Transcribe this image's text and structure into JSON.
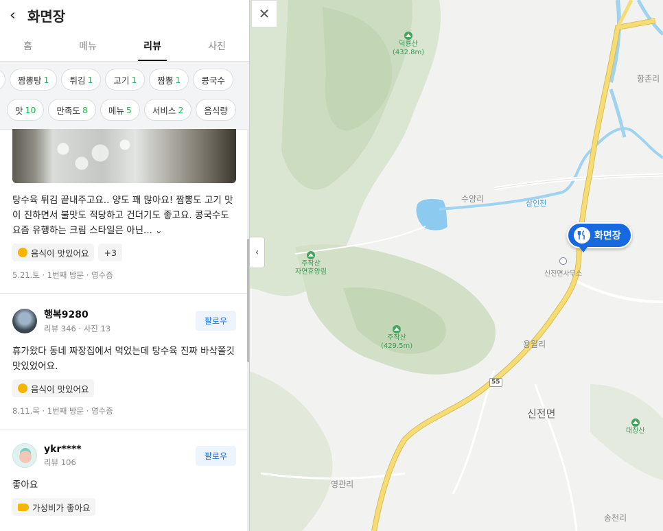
{
  "panel": {
    "title": "화면장",
    "tabs": [
      {
        "label": "홈"
      },
      {
        "label": "메뉴"
      },
      {
        "label": "리뷰"
      },
      {
        "label": "사진"
      }
    ],
    "keyword_chips_row1": [
      {
        "label": "짬뽕탕",
        "count": "1"
      },
      {
        "label": "튀김",
        "count": "1"
      },
      {
        "label": "고기",
        "count": "1"
      },
      {
        "label": "짬뽕",
        "count": "1"
      },
      {
        "label": "콩국수",
        "count": ""
      }
    ],
    "keyword_chips_row2": [
      {
        "label": "맛",
        "count": "10"
      },
      {
        "label": "만족도",
        "count": "8"
      },
      {
        "label": "메뉴",
        "count": "5"
      },
      {
        "label": "서비스",
        "count": "2"
      },
      {
        "label": "음식량",
        "count": ""
      }
    ],
    "first_review": {
      "text": "탕수육 튀김 끝내주고요.. 양도 꽤 많아요! 짬뽕도 고기 맛이 진하면서 불맛도 적당하고 건더기도 좋고요. 콩국수도 요즘 유행하는 크림 스타일은 아닌...",
      "more_icon": "chevron-down",
      "tag": "음식이 맛있어요",
      "extra_tags": "+3",
      "meta": "5.21.토 · 1번째 방문 · 영수증"
    },
    "reviews": [
      {
        "name": "행복9280",
        "stats": "리뷰 346 · 사진 13",
        "follow_label": "팔로우",
        "text": "휴가왔다 동네 짜장집에서 먹었는데 탕수육 진짜 바삭쫄깃 맛있었어요.",
        "tag": "음식이 맛있어요",
        "meta": "8.11.목 · 1번째 방문 · 영수증"
      },
      {
        "name": "ykr****",
        "stats": "리뷰 106",
        "follow_label": "팔로우",
        "text": "좋아요",
        "tag": "가성비가 좋아요"
      }
    ]
  },
  "map": {
    "marker_label": "화면장",
    "labels": {
      "deokryongsan": "덕룡산",
      "deokryongsan_height": "(432.8m)",
      "jujaksan_forest": "주작산",
      "jujaksan_forest_sub": "자연휴양림",
      "jujaksan": "주작산",
      "jujaksan_height": "(429.5m)",
      "suyangri": "수양리",
      "samincheon": "삼인천",
      "office": "신전면사무소",
      "yongwolri": "용월리",
      "sinjeonmyeon": "신전면",
      "daechangsan": "대창산",
      "yeonggwanri": "영관리",
      "songcheonri": "송천리",
      "hangchonri": "항촌리",
      "route": "55"
    },
    "colors": {
      "marker": "#1769e0",
      "road": "#f3d567",
      "water": "#8ccbef",
      "forest": "#d7e3cc"
    }
  }
}
